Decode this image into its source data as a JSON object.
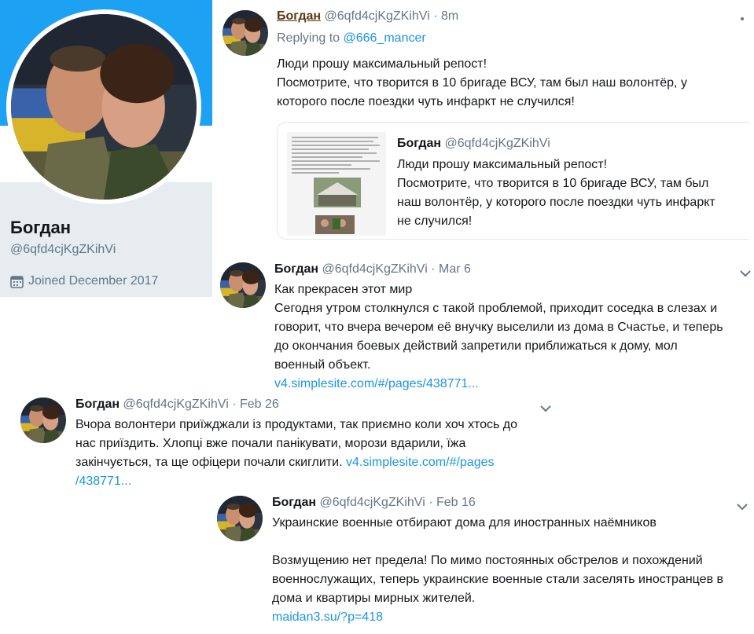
{
  "profile": {
    "name": "Богдан",
    "handle": "@6qfd4cjKgZKihVi",
    "joined": "Joined December 2017"
  },
  "tweets": [
    {
      "name": "Богдан",
      "handle": "@6qfd4cjKgZKihVi",
      "dot": "·",
      "time": "8m",
      "reply_prefix": "Replying to",
      "reply_user": "@666_mancer",
      "lines": [
        "Люди прошу максимальный репост!",
        "Посмотрите, что творится в 10 бригаде ВСУ, там был наш волонтёр, у",
        "которого после поездки чуть инфаркт не случился!"
      ],
      "quote": {
        "name": "Богдан",
        "handle": "@6qfd4cjKgZKihVi",
        "lines": [
          "Люди прошу максимальный репост!",
          "Посмотрите, что творится в 10 бригаде ВСУ, там был",
          "наш волонтёр, у которого после поездки чуть инфаркт",
          "не случился!"
        ]
      }
    },
    {
      "name": "Богдан",
      "handle": "@6qfd4cjKgZKihVi",
      "dot": "·",
      "time": "Mar 6",
      "lines": [
        "Как прекрасен этот мир",
        "Сегодня утром столкнулся с такой проблемой, приходит соседка в слезах и",
        "говорит, что вчера вечером её внучку выселили из дома в Счастье, и теперь",
        "до окончания боевых действий запретили приближаться к дому, мол",
        "военный объект."
      ],
      "link": "v4.simplesite.com/#/pages/438771..."
    },
    {
      "name": "Богдан",
      "handle": "@6qfd4cjKgZKihVi",
      "dot": "·",
      "time": "Feb 26",
      "lines": [
        "Вчора волонтери приїжджали із продуктами, так приємно коли хоч хтось до",
        "нас приїздить. Хлопці вже почали панікувати, морози вдарили, їжа",
        "закінчується, та ще офіцери почали скиглити."
      ],
      "link_a": "v4.simplesite.com/#/pages",
      "link_b": "/438771..."
    },
    {
      "name": "Богдан",
      "handle": "@6qfd4cjKgZKihVi",
      "dot": "·",
      "time": "Feb 16",
      "lines": [
        "Украинские военные отбирают дома для иностранных наёмников",
        "",
        "Возмущению нет предела! По мимо постоянных обстрелов и похождений",
        "военнослужащих, теперь украинские военные стали заселять иностранцев в",
        "дома и квартиры мирных жителей."
      ],
      "link": "maidan3.su/?p=418"
    }
  ],
  "colors": {
    "banner": "#1da1f2",
    "card_bg": "#e6ecf0",
    "link": "#1b95e0",
    "muted": "#657786"
  }
}
